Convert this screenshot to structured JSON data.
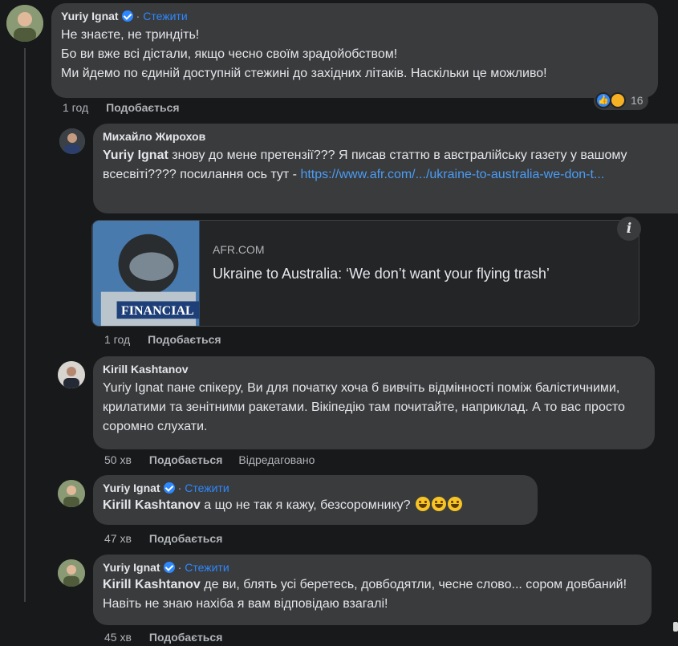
{
  "comments": [
    {
      "author": "Yuriy Ignat",
      "follow": "Стежити",
      "lines": [
        "Не знаєте, не триндіть!",
        "Бо ви вже всі дістали, якщо чесно своїм зрадойобством!",
        "Ми йдемо по єдиній доступній стежині до західних літаків. Наскільки це можливо!"
      ],
      "time": "1 год",
      "like": "Подобається",
      "reaction_count": "16"
    },
    {
      "author": "Михайло Жирохов",
      "mention": "Yuriy Ignat",
      "text": " знову до мене претензії??? Я писав статтю в австралійську газету у вашому всесвіті???? посилання ось тут - ",
      "link": "https://www.afr.com/.../ukraine-to-australia-we-don-t...",
      "card_domain": "AFR.COM",
      "card_title": "Ukraine to Australia: ‘We don’t want your flying trash’",
      "card_image_caption": "FINANCIAL",
      "info": "i",
      "time": "1 год",
      "like": "Подобається"
    },
    {
      "author": "Kirill Kashtanov",
      "mention": "Yuriy Ignat",
      "text": " пане спікеру, Ви для початку хоча б вивчіть відмінності поміж балістичними, крилатими та зенітними ракетами. Вікіпедію там почитайте, наприклад. А то вас просто соромно слухати.",
      "time": "50 хв",
      "like": "Подобається",
      "edited": "Відредаговано"
    },
    {
      "author": "Yuriy Ignat",
      "follow": "Стежити",
      "mention": "Kirill Kashtanov",
      "text": " а що не так я кажу, безсоромнику?",
      "time": "47 хв",
      "like": "Подобається"
    },
    {
      "author": "Yuriy Ignat",
      "follow": "Стежити",
      "mention": "Kirill Kashtanov",
      "text": " де ви, блять усі беретесь, довбодятли, чесне слово... сором довбаний! Навіть не знаю нахіба я вам відповідаю взагалі!",
      "time": "45 хв",
      "like": "Подобається"
    }
  ],
  "colors": {
    "background": "#18191a",
    "bubble": "#3a3b3c",
    "accent": "#2d88ff"
  }
}
